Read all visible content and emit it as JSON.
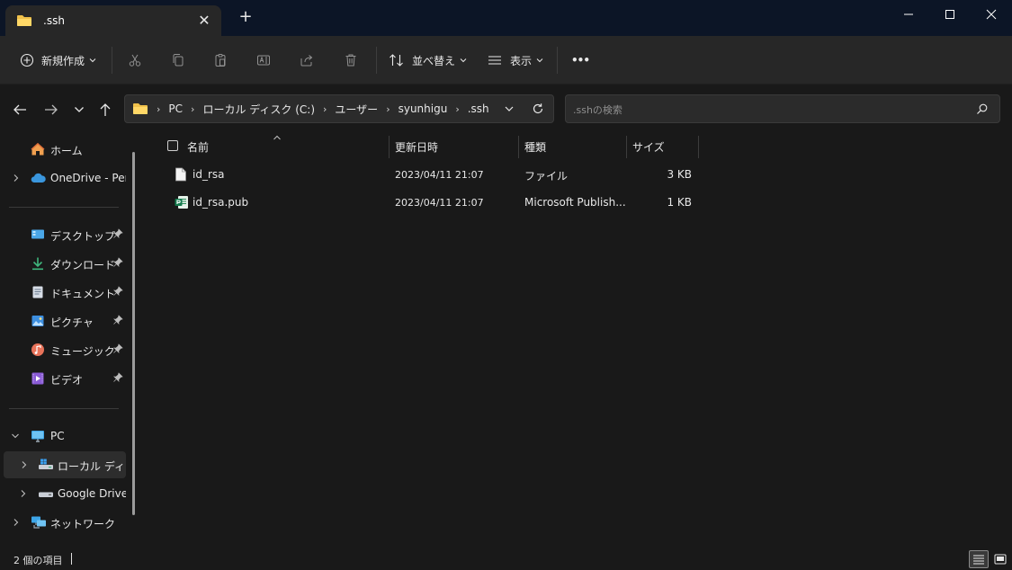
{
  "window": {
    "tab_title": ".ssh",
    "tab_close": "✕",
    "new_tab": "+"
  },
  "toolbar": {
    "new_label": "新規作成",
    "sort_label": "並べ替え",
    "view_label": "表示",
    "more_label": "•••"
  },
  "breadcrumb": [
    "PC",
    "ローカル ディスク (C:)",
    "ユーザー",
    "syunhigu",
    ".ssh"
  ],
  "search": {
    "placeholder": ".sshの検索"
  },
  "sidebar": {
    "home": "ホーム",
    "onedrive": "OneDrive - Perso",
    "quick": [
      {
        "label": "デスクトップ",
        "icon": "desktop-icon"
      },
      {
        "label": "ダウンロード",
        "icon": "download-icon"
      },
      {
        "label": "ドキュメント",
        "icon": "document-icon"
      },
      {
        "label": "ピクチャ",
        "icon": "pictures-icon"
      },
      {
        "label": "ミュージック",
        "icon": "music-icon"
      },
      {
        "label": "ビデオ",
        "icon": "video-icon"
      }
    ],
    "pc": "PC",
    "local_disk": "ローカル ディスク",
    "google_drive": "Google Drive (",
    "network": "ネットワーク"
  },
  "columns": {
    "name": "名前",
    "date": "更新日時",
    "type": "種類",
    "size": "サイズ"
  },
  "files": [
    {
      "name": "id_rsa",
      "date": "2023/04/11 21:07",
      "type": "ファイル",
      "size": "3 KB",
      "icon": "file-icon"
    },
    {
      "name": "id_rsa.pub",
      "date": "2023/04/11 21:07",
      "type": "Microsoft Publish...",
      "size": "1 KB",
      "icon": "publisher-icon"
    }
  ],
  "status": {
    "count": "2 個の項目"
  },
  "colors": {
    "folder": "#f0c14b",
    "accent": "#4cc2ff",
    "titlebar": "#0c1526",
    "toolbar": "#272727",
    "background": "#191919"
  }
}
